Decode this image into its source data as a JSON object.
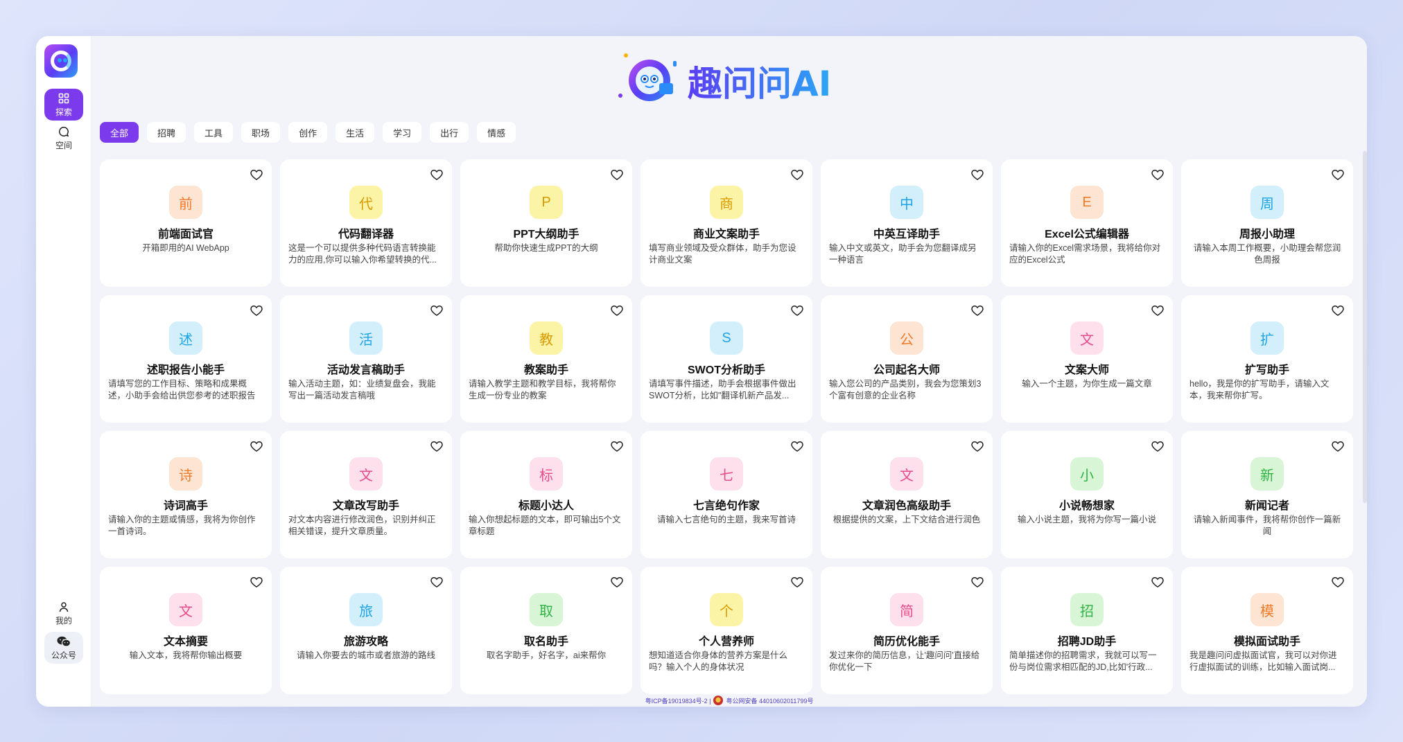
{
  "brand": {
    "logo_text": "趣问问AI"
  },
  "sidebar": {
    "items": [
      {
        "label": "探索",
        "icon": "grid-icon"
      },
      {
        "label": "空间",
        "icon": "chat-bubble-icon"
      }
    ],
    "bottom_items": [
      {
        "label": "我的",
        "icon": "user-icon"
      },
      {
        "label": "公众号",
        "icon": "wechat-icon"
      }
    ]
  },
  "tabs": [
    "全部",
    "招聘",
    "工具",
    "职场",
    "创作",
    "生活",
    "学习",
    "出行",
    "情感"
  ],
  "colors": {
    "accent": "#7c3aed",
    "orange": {
      "bg": "#fde4d3",
      "fg": "#f07c2a"
    },
    "yellow": {
      "bg": "#fbf3a6",
      "fg": "#d99a00"
    },
    "blue": {
      "bg": "#d3effc",
      "fg": "#1ea3e6"
    },
    "pink": {
      "bg": "#fde0ec",
      "fg": "#e84a8a"
    },
    "green": {
      "bg": "#d8f6d6",
      "fg": "#2fb344"
    }
  },
  "cards": [
    {
      "char": "前",
      "color": "orange",
      "title": "前端面试官",
      "desc": "开箱即用的AI WebApp"
    },
    {
      "char": "代",
      "color": "yellow",
      "title": "代码翻译器",
      "desc": "这是一个可以提供多种代码语言转换能力的应用,你可以输入你希望转换的代..."
    },
    {
      "char": "P",
      "color": "yellow",
      "title": "PPT大纲助手",
      "desc": "帮助你快速生成PPT的大纲"
    },
    {
      "char": "商",
      "color": "yellow",
      "title": "商业文案助手",
      "desc": "填写商业领域及受众群体，助手为您设计商业文案"
    },
    {
      "char": "中",
      "color": "blue",
      "title": "中英互译助手",
      "desc": "输入中文或英文，助手会为您翻译成另一种语言"
    },
    {
      "char": "E",
      "color": "orange",
      "title": "Excel公式编辑器",
      "desc": "请输入你的Excel需求场景，我将给你对应的Excel公式"
    },
    {
      "char": "周",
      "color": "blue",
      "title": "周报小助理",
      "desc": "请输入本周工作概要，小助理会帮您润色周报"
    },
    {
      "char": "述",
      "color": "blue",
      "title": "述职报告小能手",
      "desc": "请填写您的工作目标、策略和成果概述，小助手会给出供您参考的述职报告"
    },
    {
      "char": "活",
      "color": "blue",
      "title": "活动发言稿助手",
      "desc": "输入活动主题，如：业绩复盘会，我能写出一篇活动发言稿哦"
    },
    {
      "char": "教",
      "color": "yellow",
      "title": "教案助手",
      "desc": "请输入教学主题和教学目标，我将帮你生成一份专业的教案"
    },
    {
      "char": "S",
      "color": "blue",
      "title": "SWOT分析助手",
      "desc": "请填写事件描述，助手会根据事件做出SWOT分析，比如\"翻译机新产品发..."
    },
    {
      "char": "公",
      "color": "orange",
      "title": "公司起名大师",
      "desc": "输入您公司的产品类别，我会为您策划3个富有创意的企业名称"
    },
    {
      "char": "文",
      "color": "pink",
      "title": "文案大师",
      "desc": "输入一个主题，为你生成一篇文章"
    },
    {
      "char": "扩",
      "color": "blue",
      "title": "扩写助手",
      "desc": "hello，我是你的扩写助手，请输入文本，我来帮你扩写。"
    },
    {
      "char": "诗",
      "color": "orange",
      "title": "诗词高手",
      "desc": "请输入你的主题或情感，我将为你创作一首诗词。"
    },
    {
      "char": "文",
      "color": "pink",
      "title": "文章改写助手",
      "desc": "对文本内容进行修改润色，识别并纠正相关错误，提升文章质量。"
    },
    {
      "char": "标",
      "color": "pink",
      "title": "标题小达人",
      "desc": "输入你想起标题的文本，即可输出5个文章标题"
    },
    {
      "char": "七",
      "color": "pink",
      "title": "七言绝句作家",
      "desc": "请输入七言绝句的主题，我来写首诗"
    },
    {
      "char": "文",
      "color": "pink",
      "title": "文章润色高级助手",
      "desc": "根据提供的文案，上下文结合进行润色"
    },
    {
      "char": "小",
      "color": "green",
      "title": "小说畅想家",
      "desc": "输入小说主题，我将为你写一篇小说"
    },
    {
      "char": "新",
      "color": "green",
      "title": "新闻记者",
      "desc": "请输入新闻事件，我将帮你创作一篇新闻"
    },
    {
      "char": "文",
      "color": "pink",
      "title": "文本摘要",
      "desc": "输入文本，我将帮你输出概要"
    },
    {
      "char": "旅",
      "color": "blue",
      "title": "旅游攻略",
      "desc": "请输入你要去的城市或者旅游的路线"
    },
    {
      "char": "取",
      "color": "green",
      "title": "取名助手",
      "desc": "取名字助手，好名字，ai来帮你"
    },
    {
      "char": "个",
      "color": "yellow",
      "title": "个人营养师",
      "desc": "想知道适合你身体的营养方案是什么吗？输入个人的身体状况"
    },
    {
      "char": "简",
      "color": "pink",
      "title": "简历优化能手",
      "desc": "发过来你的简历信息，让'趣问问'直接给你优化一下"
    },
    {
      "char": "招",
      "color": "green",
      "title": "招聘JD助手",
      "desc": "简单描述你的招聘需求，我就可以写一份与岗位需求相匹配的JD,比如'行政..."
    },
    {
      "char": "模",
      "color": "orange",
      "title": "模拟面试助手",
      "desc": "我是趣问问虚拟面试官，我可以对你进行虚拟面试的训练，比如输入面试岗..."
    }
  ],
  "footer": {
    "icp": "粤ICP备19019834号-2 |",
    "police": "粤公网安备 44010602011799号"
  }
}
